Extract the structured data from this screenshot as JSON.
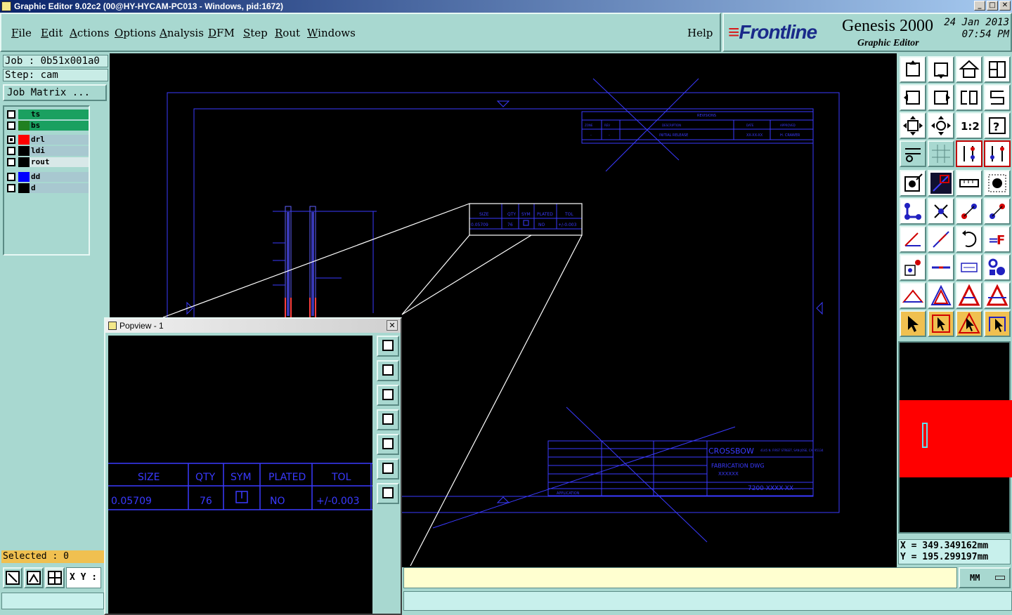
{
  "window": {
    "title": "Graphic Editor 9.02c2 (00@HY-HYCAM-PC013 - Windows, pid:1672)"
  },
  "menu": [
    {
      "label": "File",
      "key": "F",
      "rest": "ile"
    },
    {
      "label": "Edit",
      "key": "E",
      "rest": "dit"
    },
    {
      "label": "Actions",
      "key": "A",
      "rest": "ctions"
    },
    {
      "label": "Options",
      "key": "O",
      "rest": "ptions"
    },
    {
      "label": "Analysis",
      "key": "A",
      "rest": "nalysis"
    },
    {
      "label": "DFM",
      "key": "D",
      "rest": "FM"
    },
    {
      "label": "Step",
      "key": "S",
      "rest": "tep"
    },
    {
      "label": "Rout",
      "key": "R",
      "rest": "out"
    },
    {
      "label": "Windows",
      "key": "W",
      "rest": "indows"
    }
  ],
  "help": "Help",
  "brand": {
    "logo": "Frontline",
    "product": "Genesis 2000",
    "subtitle": "Graphic Editor",
    "date": "24 Jan 2013",
    "time": "07:54 PM"
  },
  "job": {
    "job_line": "Job : 0b51x001a0",
    "step_line": "Step: cam",
    "matrix_button": "Job Matrix ..."
  },
  "layers": [
    {
      "name": "ts",
      "color": "#1aa060",
      "bg": "#1aa060",
      "checked": false
    },
    {
      "name": "bs",
      "color": "#208020",
      "bg": "#1aa060",
      "checked": false
    },
    {
      "name": "drl",
      "color": "#ff0000",
      "bg": "#a8c8d0",
      "checked": true
    },
    {
      "name": "ldi",
      "color": "#000000",
      "bg": "#a8c8d0",
      "checked": false
    },
    {
      "name": "rout",
      "color": "#000000",
      "bg": "#d8e8e8",
      "checked": false
    },
    {
      "name": "dd",
      "color": "#0000ff",
      "bg": "#a8c8d0",
      "checked": false
    },
    {
      "name": "d",
      "color": "#000000",
      "bg": "#a8c8d0",
      "checked": false
    }
  ],
  "selected": "Selected : 0",
  "xy_label": "X Y :",
  "coords": {
    "x": "X = 349.349162mm",
    "y": "Y = 195.299197mm"
  },
  "units": "MM",
  "popview": {
    "title": "Popview - 1",
    "close": "✕",
    "table_headers": [
      "SIZE",
      "QTY",
      "SYM",
      "PLATED",
      "TOL"
    ],
    "table_row": [
      "0.05709",
      "76",
      "",
      "NO",
      "+/-0.003"
    ]
  },
  "drawing": {
    "revisions": "REVISIONS",
    "rev_headers": [
      "ZONE",
      "REV",
      "DESCRIPTION",
      "DATE",
      "APPROVED"
    ],
    "rev_row": [
      "-",
      "-",
      "INITIAL RELEASE",
      "XX-XX-XX",
      "H. CRAWER"
    ],
    "company": "CROSSBOW",
    "address": "4145 N. FIRST STREET, SAN JOSE, CA. 95134",
    "doc_title": "FABRICATION DWG",
    "doc_sub": "XXXXXX",
    "part_no": "7200-XXXX-XX",
    "application": "APPLICATION"
  },
  "colors": {
    "accent": "#a8d8d0",
    "drawing": "#3a3aff",
    "minimap": "#ff0000",
    "selected": "#f0c050"
  }
}
